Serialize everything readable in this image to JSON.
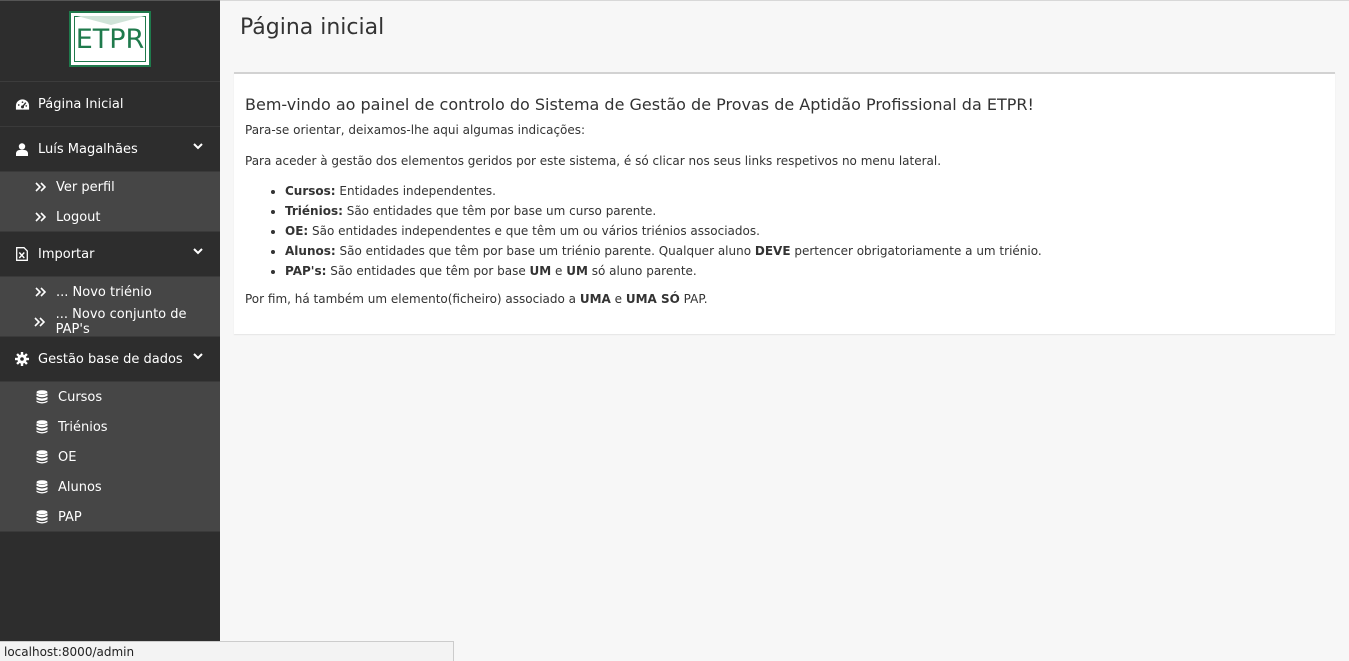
{
  "logo_text": "ETPR",
  "sidebar": {
    "home": {
      "label": "Página Inicial",
      "icon": "dashboard-icon"
    },
    "user": {
      "label": "Luís Magalhães",
      "icon": "user-icon",
      "items": [
        {
          "label": "Ver perfil"
        },
        {
          "label": "Logout"
        }
      ]
    },
    "import": {
      "label": "Importar",
      "icon": "excel-file-icon",
      "items": [
        {
          "label": "... Novo triénio"
        },
        {
          "label": "... Novo conjunto de PAP's"
        }
      ]
    },
    "db": {
      "label": "Gestão base de dados",
      "icon": "gear-icon",
      "items": [
        {
          "label": "Cursos"
        },
        {
          "label": "Triénios"
        },
        {
          "label": "OE"
        },
        {
          "label": "Alunos"
        },
        {
          "label": "PAP"
        }
      ]
    }
  },
  "main": {
    "title": "Página inicial",
    "welcome": "Bem-vindo ao painel de controlo do Sistema de Gestão de Provas de Aptidão Profissional da ETPR!",
    "intro": "Para-se orientar, deixamos-lhe aqui algumas indicações:",
    "instructions": "Para aceder à gestão dos elementos geridos por este sistema, é só clicar nos seus links respetivos no menu lateral.",
    "list": [
      {
        "term": "Cursos:",
        "text": " Entidades independentes."
      },
      {
        "term": "Triénios:",
        "text": " São entidades que têm por base um curso parente."
      },
      {
        "term": "OE:",
        "text": " São entidades independentes e que têm um ou vários triénios associados."
      },
      {
        "term": "Alunos:",
        "text": " São entidades que têm por base um triénio parente. Qualquer aluno ",
        "strong": "DEVE",
        "after": " pertencer obrigatoriamente a um triénio."
      },
      {
        "term": "PAP's:",
        "text": " São entidades que têm por base ",
        "strong": "UM",
        "mid": " e ",
        "strong2": "UM",
        "after": " só aluno parente."
      }
    ],
    "footer_text_1": "Por fim, há também um elemento(ficheiro) associado a ",
    "footer_strong_1": "UMA",
    "footer_text_2": " e ",
    "footer_strong_2": "UMA SÓ",
    "footer_text_3": " PAP."
  },
  "status_url": "localhost:8000/admin",
  "colors": {
    "sidebar_bg": "#2d2d2d",
    "submenu_bg": "#464646",
    "logo_green": "#1f7a4c"
  }
}
